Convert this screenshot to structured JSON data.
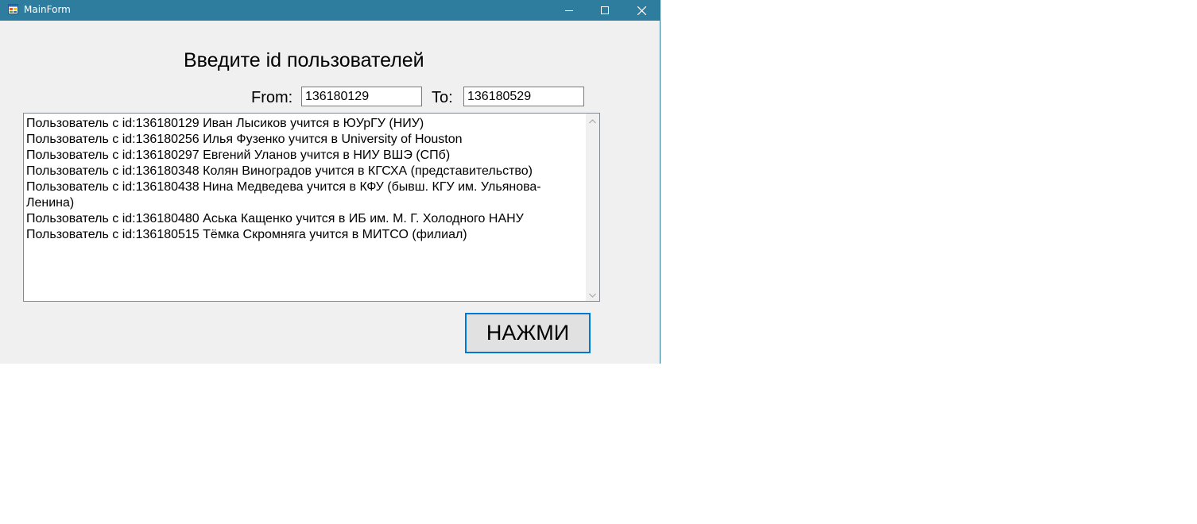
{
  "window": {
    "title": "MainForm",
    "icon": "form-icon",
    "controls": {
      "minimize_icon": "minimize-icon",
      "maximize_icon": "maximize-icon",
      "close_icon": "close-icon"
    }
  },
  "form": {
    "heading": "Введите id пользователей",
    "from_label": "From:",
    "from_value": "136180129",
    "to_label": "To:",
    "to_value": "136180529",
    "results": [
      "Пользователь с id:136180129 Иван Лысиков учится в ЮУрГУ (НИУ)",
      "Пользователь с id:136180256 Илья Фузенко учится в University of Houston",
      "Пользователь с id:136180297 Евгений Уланов учится в НИУ ВШЭ (СПб)",
      "Пользователь с id:136180348 Колян Виноградов учится в КГСХА (представительство)",
      "Пользователь с id:136180438 Нина Медведева учится в КФУ (бывш. КГУ им. Ульянова-Ленина)",
      "Пользователь с id:136180480 Аська Кащенко учится в ИБ им. М. Г. Холодного НАНУ",
      "Пользователь с id:136180515 Тёмка Скромняга учится в МИТСО (филиал)"
    ],
    "button_label": "НАЖМИ"
  },
  "colors": {
    "titlebar": "#2f7d9e",
    "form_background": "#f0f0f0",
    "button_border": "#0078d7",
    "button_background": "#e1e1e1"
  }
}
